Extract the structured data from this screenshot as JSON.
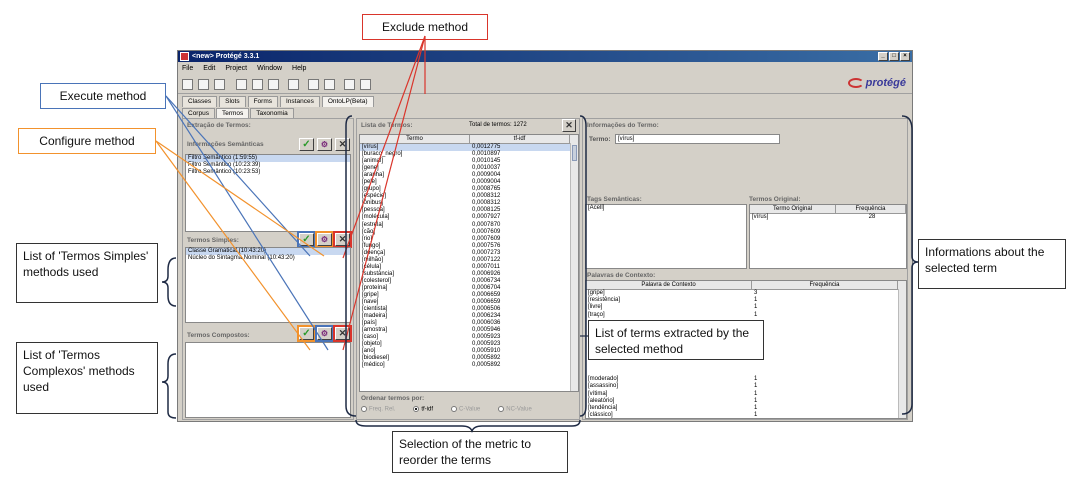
{
  "window": {
    "title": "<new> Protégé 3.3.1",
    "menu": [
      "File",
      "Edit",
      "Project",
      "Window",
      "Help"
    ],
    "logo_text": "protégé",
    "main_tabs": [
      "Classes",
      "Slots",
      "Forms",
      "Instances",
      "OntoLP(Beta)"
    ],
    "sub_tabs": [
      "Corpus",
      "Termos",
      "Taxonomia"
    ]
  },
  "left_panel": {
    "extraction_title": "Extração de Termos:",
    "semantic_title": "Informações Semânticas",
    "semantic_items": [
      "Filtro Semântico (1:59:55)",
      "Filtro Semântico (10:23:39)",
      "Filtro Semântico (10:23:53)"
    ],
    "simple_title": "Termos Simples:",
    "simple_items": [
      "Classe Gramatical (10:43:20)",
      "Núcleo do Sintagma Nominal (10:43:20)"
    ],
    "complex_title": "Termos Compostos:"
  },
  "terms_panel": {
    "title": "Lista de Termos:",
    "total": "Total de termos: 1272",
    "col_term": "Termo",
    "col_metric": "tf-idf",
    "rows": [
      [
        "[vírus]",
        "0,0012775"
      ],
      [
        "[buraco_negro]",
        "0,0010897"
      ],
      [
        "[animal]",
        "0,0010145"
      ],
      [
        "[gene]",
        "0,0010037"
      ],
      [
        "[aranha]",
        "0,0009004"
      ],
      [
        "[pele]",
        "0,0009004"
      ],
      [
        "[grupo]",
        "0,0008765"
      ],
      [
        "[espécie]",
        "0,0008312"
      ],
      [
        "[ônibus]",
        "0,0008312"
      ],
      [
        "[pessoa]",
        "0,0008125"
      ],
      [
        "[molécula]",
        "0,0007927"
      ],
      [
        "[estrela]",
        "0,0007870"
      ],
      [
        "[cão]",
        "0,0007609"
      ],
      [
        "[rio]",
        "0,0007609"
      ],
      [
        "[fungo]",
        "0,0007576"
      ],
      [
        "[doença]",
        "0,0007273"
      ],
      [
        "[milhão]",
        "0,0007122"
      ],
      [
        "[célula]",
        "0,0007011"
      ],
      [
        "[substância]",
        "0,0006926"
      ],
      [
        "[colesterol]",
        "0,0006734"
      ],
      [
        "[proteína]",
        "0,0006704"
      ],
      [
        "[gripe]",
        "0,0006659"
      ],
      [
        "[nave]",
        "0,0006659"
      ],
      [
        "[cientista]",
        "0,0006506"
      ],
      [
        "[madeira]",
        "0,0006234"
      ],
      [
        "[país]",
        "0,0006036"
      ],
      [
        "[amostra]",
        "0,0005946"
      ],
      [
        "[caso]",
        "0,0005923"
      ],
      [
        "[objeto]",
        "0,0005923"
      ],
      [
        "[ano]",
        "0,0005910"
      ],
      [
        "[biodiesel]",
        "0,0005892"
      ],
      [
        "[médico]",
        "0,0005892"
      ]
    ],
    "order_label": "Ordenar termos por:",
    "order_options": [
      "Freq. Rel.",
      "tf-idf",
      "C-Value",
      "NC-Value"
    ],
    "order_selected": "tf-idf"
  },
  "info_panel": {
    "title": "Informações do Termo:",
    "term_label": "Termo:",
    "term_value": "[vírus]",
    "tags_title": "Tags Semânticas:",
    "tags_items": [
      "[Acell]"
    ],
    "original_title": "Termos Original:",
    "original_cols": [
      "Termo Original",
      "Frequência"
    ],
    "original_rows": [
      [
        "[vírus]",
        "28"
      ]
    ],
    "context_title": "Palavras de Contexto:",
    "context_cols": [
      "Palavra de Contexto",
      "Frequência"
    ],
    "context_rows": [
      [
        "[gripe]",
        "3"
      ],
      [
        "[resistência]",
        "1"
      ],
      [
        "[livre]",
        "1"
      ],
      [
        "[traço]",
        "1"
      ],
      [
        "",
        ""
      ],
      [
        "",
        ""
      ],
      [
        "",
        ""
      ],
      [
        "",
        ""
      ],
      [
        "",
        ""
      ],
      [
        "",
        ""
      ],
      [
        "",
        ""
      ],
      [
        "",
        ""
      ],
      [
        "[moderado]",
        "1"
      ],
      [
        "[assassino]",
        "1"
      ],
      [
        "[vítima]",
        "1"
      ],
      [
        "[aleatório]",
        "1"
      ],
      [
        "[tendência]",
        "1"
      ],
      [
        "[clássico]",
        "1"
      ],
      [
        "[boca]",
        "1"
      ]
    ]
  },
  "callouts": {
    "exclude": "Exclude method",
    "execute": "Execute method",
    "configure": "Configure method",
    "simple_list": "List of 'Termos Simples' methods used",
    "complex_list": "List of 'Termos Complexos' methods used",
    "info": "Informations about the selected term",
    "terms_list": "List of terms extracted by the selected method",
    "metric": "Selection of the metric to reorder the terms"
  },
  "colors": {
    "execute": "#4a74b8",
    "configure": "#f2922d",
    "exclude": "#d9352b"
  }
}
